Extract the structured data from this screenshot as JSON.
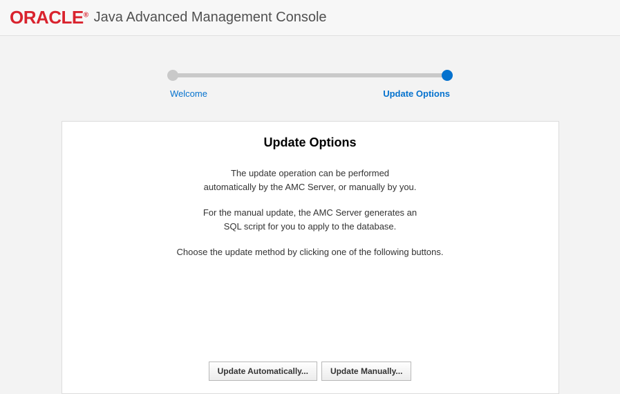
{
  "header": {
    "brand": "ORACLE",
    "brand_mark": "®",
    "title": "Java Advanced Management Console"
  },
  "progress": {
    "step1_label": "Welcome",
    "step2_label": "Update Options"
  },
  "panel": {
    "heading": "Update Options",
    "para1_line1": "The update operation can be performed",
    "para1_line2": "automatically by the AMC Server, or manually by you.",
    "para2_line1": "For the manual update, the AMC Server generates an",
    "para2_line2": "SQL script for you to apply to the database.",
    "para3": "Choose the update method by clicking one of the following buttons.",
    "btn_auto": "Update Automatically...",
    "btn_manual": "Update Manually..."
  }
}
